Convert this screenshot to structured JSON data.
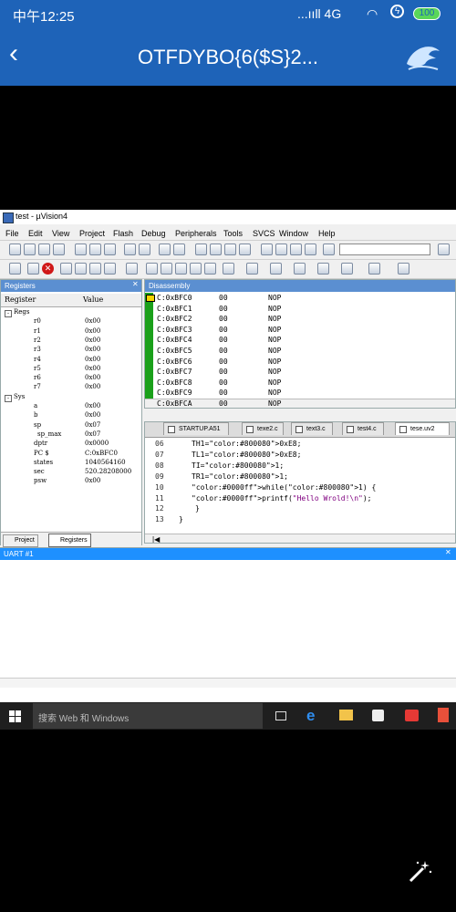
{
  "status": {
    "carrier_time": "中午12:25",
    "signal_text": "...ııll 4G",
    "battery": "100"
  },
  "header": {
    "title": "OTFDYBO{6($S}2..."
  },
  "window": {
    "title": "test - µVision4",
    "menu": [
      "File",
      "Edit",
      "View",
      "Project",
      "Flash",
      "Debug",
      "Peripherals",
      "Tools",
      "SVCS",
      "Window",
      "Help"
    ]
  },
  "registers": {
    "title": "Registers",
    "col_register": "Register",
    "col_value": "Value",
    "regs_group": "Regs",
    "regs": [
      {
        "name": "r0",
        "value": "0x00"
      },
      {
        "name": "r1",
        "value": "0x00"
      },
      {
        "name": "r2",
        "value": "0x00"
      },
      {
        "name": "r3",
        "value": "0x00"
      },
      {
        "name": "r4",
        "value": "0x00"
      },
      {
        "name": "r5",
        "value": "0x00"
      },
      {
        "name": "r6",
        "value": "0x00"
      },
      {
        "name": "r7",
        "value": "0x00"
      }
    ],
    "sys_group": "Sys",
    "sys": [
      {
        "name": "a",
        "value": "0x00"
      },
      {
        "name": "b",
        "value": "0x00"
      },
      {
        "name": "sp",
        "value": "0x07"
      },
      {
        "name": "sp_max",
        "value": "0x07"
      },
      {
        "name": "dptr",
        "value": "0x0000"
      },
      {
        "name": "PC  $",
        "value": "C:0xBFC0"
      },
      {
        "name": "states",
        "value": "1040564160"
      },
      {
        "name": "sec",
        "value": "520.28208000"
      },
      {
        "name": "psw",
        "value": "0x00"
      }
    ],
    "bottom_tabs": [
      "Project",
      "Registers"
    ]
  },
  "disassembly": {
    "title": "Disassembly",
    "rows": [
      {
        "addr": "C:0xBFC0",
        "code": "00",
        "ins": "NOP"
      },
      {
        "addr": "C:0xBFC1",
        "code": "00",
        "ins": "NOP"
      },
      {
        "addr": "C:0xBFC2",
        "code": "00",
        "ins": "NOP"
      },
      {
        "addr": "C:0xBFC3",
        "code": "00",
        "ins": "NOP"
      },
      {
        "addr": "C:0xBFC4",
        "code": "00",
        "ins": "NOP"
      },
      {
        "addr": "C:0xBFC5",
        "code": "00",
        "ins": "NOP"
      },
      {
        "addr": "C:0xBFC6",
        "code": "00",
        "ins": "NOP"
      },
      {
        "addr": "C:0xBFC7",
        "code": "00",
        "ins": "NOP"
      },
      {
        "addr": "C:0xBFC8",
        "code": "00",
        "ins": "NOP"
      },
      {
        "addr": "C:0xBFC9",
        "code": "00",
        "ins": "NOP"
      },
      {
        "addr": "C:0xBFCA",
        "code": "00",
        "ins": "NOP"
      }
    ]
  },
  "editor": {
    "tabs": [
      "STARTUP.A51",
      "texe2.c",
      "text3.c",
      "test4.c",
      "tese.uv2"
    ],
    "lines": [
      {
        "n": "06",
        "t": "TH1=0xE8;"
      },
      {
        "n": "07",
        "t": "TL1=0xE8;"
      },
      {
        "n": "08",
        "t": "TI=1;"
      },
      {
        "n": "09",
        "t": "TR1=1;"
      },
      {
        "n": "10",
        "t": "while(1) {"
      },
      {
        "n": "11",
        "t": "printf(\"Hello Wrold!\\n\");"
      },
      {
        "n": "12",
        "t": "}"
      },
      {
        "n": "13",
        "t": "}"
      }
    ]
  },
  "uart": {
    "title": "UART #1"
  },
  "taskbar": {
    "search_placeholder": "搜索 Web 和 Windows"
  },
  "colors": {
    "header_blue": "#1e63b8",
    "panel_title_blue": "#5b8fd1",
    "uart_blue": "#1e90ff",
    "gutter_green": "#1aa01a",
    "keyword_blue": "#0000ff",
    "number_purple": "#800080"
  }
}
